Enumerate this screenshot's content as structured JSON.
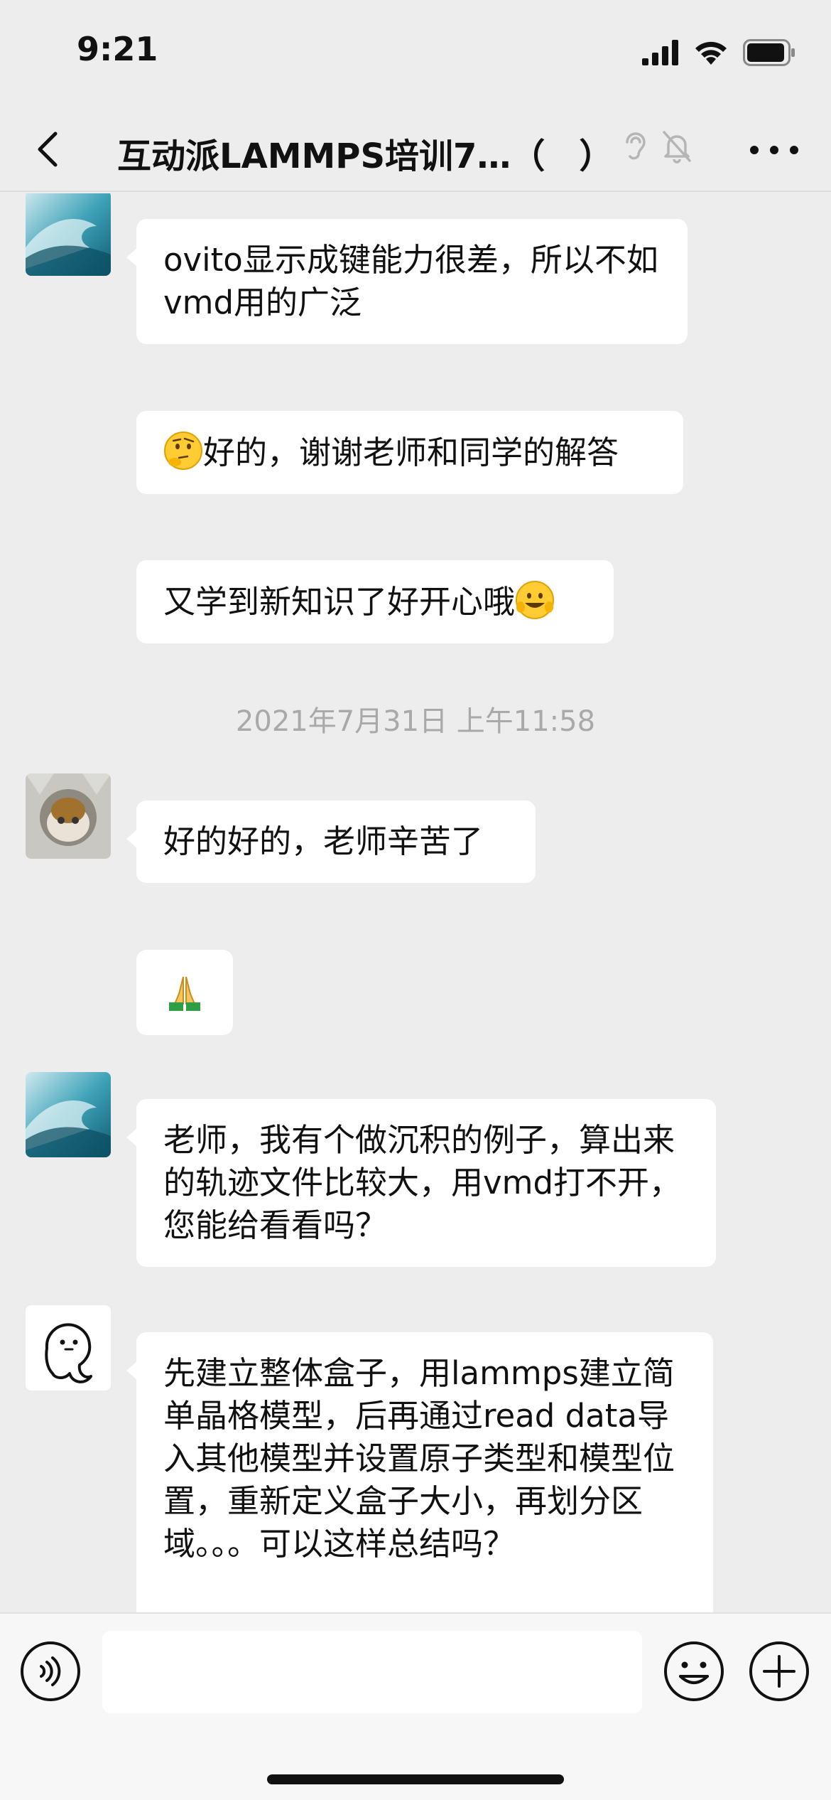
{
  "status_bar": {
    "time": "9:21"
  },
  "header": {
    "title": "互动派LAMMPS培训7…（　）",
    "icons": [
      "back-arrow-icon",
      "ear-icon",
      "mute-bell-icon",
      "more-dots-icon"
    ]
  },
  "messages": [
    {
      "type": "text",
      "avatar": "wave-avatar",
      "text": "ovito显示成键能力很差，所以不如vmd用的广泛"
    },
    {
      "type": "text",
      "avatar": null,
      "emoji_prefix": "thinking-face",
      "text": "好的，谢谢老师和同学的解答"
    },
    {
      "type": "text",
      "avatar": null,
      "text": "又学到新知识了好开心哦",
      "emoji_suffix": "grinning-face"
    },
    {
      "type": "timestamp",
      "text": "2021年7月31日 上午11:58"
    },
    {
      "type": "text",
      "avatar": "cat-avatar",
      "text": "好的好的，老师辛苦了"
    },
    {
      "type": "emoji",
      "avatar": null,
      "emoji": "folded-hands"
    },
    {
      "type": "text",
      "avatar": "wave-avatar",
      "text": "老师，我有个做沉积的例子，算出来的轨迹文件比较大，用vmd打不开，您能给看看吗？"
    },
    {
      "type": "text",
      "avatar": "ghost-avatar",
      "text": "先建立整体盒子，用lammps建立简单晶格模型，后再通过read data导入其他模型并设置原子类型和模型位置，重新定义盒子大小，再划分区域。。。可以这样总结吗？"
    }
  ],
  "input": {
    "value": "",
    "placeholder": ""
  },
  "colors": {
    "background": "#ededed",
    "bubble": "#ffffff",
    "timestamp_text": "#a9a9a9"
  }
}
